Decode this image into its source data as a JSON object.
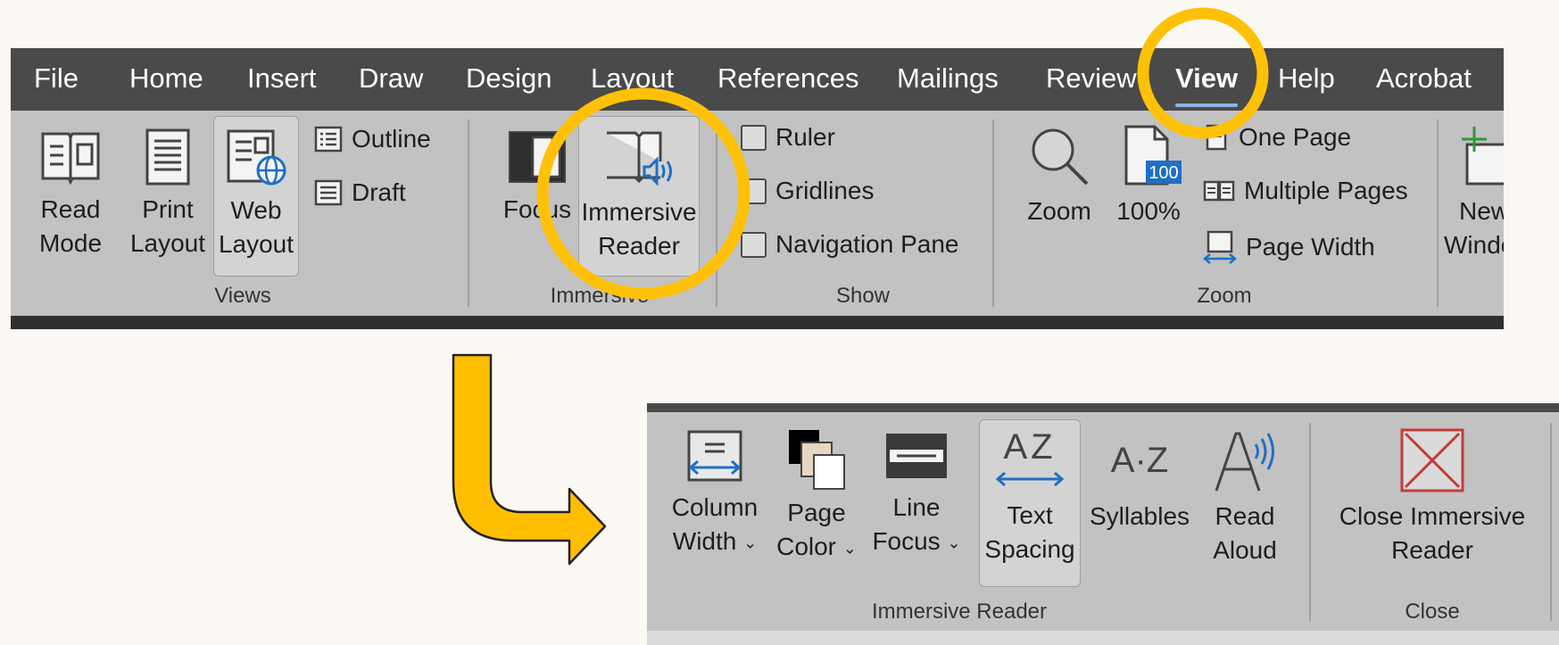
{
  "top_ribbon": {
    "tabs": [
      "File",
      "Home",
      "Insert",
      "Draw",
      "Design",
      "Layout",
      "References",
      "Mailings",
      "Review",
      "View",
      "Help",
      "Acrobat"
    ],
    "active_tab": "View",
    "views": {
      "read_mode": [
        "Read",
        "Mode"
      ],
      "print_layout": [
        "Print",
        "Layout"
      ],
      "web_layout": [
        "Web",
        "Layout"
      ],
      "outline": "Outline",
      "draft": "Draft",
      "group_label": "Views"
    },
    "immersive": {
      "focus": "Focus",
      "immersive_reader": [
        "Immersive",
        "Reader"
      ],
      "group_label": "Immersive"
    },
    "show": {
      "ruler": "Ruler",
      "gridlines": "Gridlines",
      "navigation_pane": "Navigation Pane",
      "group_label": "Show"
    },
    "zoom": {
      "zoom": "Zoom",
      "hundred": "100%",
      "hundred_badge": "100",
      "one_page": "One Page",
      "multiple_pages": "Multiple Pages",
      "page_width": "Page Width",
      "group_label": "Zoom"
    },
    "window": {
      "new_window": [
        "New",
        "Window"
      ]
    }
  },
  "bottom_ribbon": {
    "column_width": [
      "Column",
      "Width"
    ],
    "page_color": [
      "Page",
      "Color"
    ],
    "line_focus": [
      "Line",
      "Focus"
    ],
    "text_spacing": [
      "Text",
      "Spacing"
    ],
    "text_spacing_icon": "AZ",
    "syllables": "Syllables",
    "syllables_icon": "A·Z",
    "read_aloud": [
      "Read",
      "Aloud"
    ],
    "close_immersive_reader": [
      "Close Immersive",
      "Reader"
    ],
    "group_immersive_reader": "Immersive Reader",
    "group_close": "Close",
    "caret": "⌄"
  },
  "colors": {
    "highlight_ring": "#ffc107",
    "arrow_fill": "#ffbf00",
    "tab_bar": "#4a4a4a",
    "ribbon": "#c2c2c2",
    "accent_blue": "#1f6fc5",
    "close_red": "#c43b3b"
  }
}
